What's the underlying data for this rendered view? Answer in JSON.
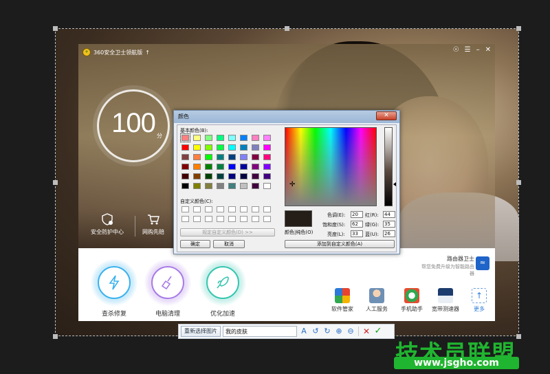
{
  "app": {
    "title": "360安全卫士领航版",
    "score": "100",
    "score_unit": "分",
    "features": [
      {
        "label": "安全防护中心",
        "icon": "shield-icon"
      },
      {
        "label": "网购先赔",
        "icon": "cart-icon"
      }
    ],
    "actions": [
      {
        "label": "查杀修复",
        "icon": "lightning-icon",
        "color": "#3bb2ee"
      },
      {
        "label": "电脑清理",
        "icon": "broom-icon",
        "color": "#a87be6"
      },
      {
        "label": "优化加速",
        "icon": "rocket-icon",
        "color": "#36c6b0"
      }
    ],
    "router": {
      "title": "路由器卫士",
      "subtitle": "帮您免费升级为智能路由器"
    },
    "tools": [
      {
        "label": "软件管家",
        "icon": "apps-icon"
      },
      {
        "label": "人工服务",
        "icon": "support-icon"
      },
      {
        "label": "手机助手",
        "icon": "phone-icon"
      },
      {
        "label": "宽带测速器",
        "icon": "speed-icon"
      },
      {
        "label": "更多",
        "icon": "more-icon"
      }
    ]
  },
  "color_dialog": {
    "title": "颜色",
    "basic_label": "基本颜色(B):",
    "custom_label": "自定义颜色(C):",
    "define_button": "规定自定义颜色(D) >>",
    "ok_button": "确定",
    "cancel_button": "取消",
    "add_button": "添加到自定义颜色(A)",
    "solid_label": "颜色|纯色(O)",
    "basic_colors": [
      "#ff8080",
      "#ffff80",
      "#80ff80",
      "#00ff80",
      "#80ffff",
      "#0080ff",
      "#ff80c0",
      "#ff80ff",
      "#ff0000",
      "#ffff00",
      "#80ff00",
      "#00ff40",
      "#00ffff",
      "#0080c0",
      "#8080c0",
      "#ff00ff",
      "#804040",
      "#ff8040",
      "#00ff00",
      "#008080",
      "#004080",
      "#8080ff",
      "#800040",
      "#ff0080",
      "#800000",
      "#ff8000",
      "#008000",
      "#008040",
      "#0000ff",
      "#0000a0",
      "#800080",
      "#8000ff",
      "#400000",
      "#804000",
      "#004000",
      "#004040",
      "#000080",
      "#000040",
      "#400040",
      "#400080",
      "#000000",
      "#808000",
      "#808040",
      "#808080",
      "#408080",
      "#c0c0c0",
      "#400040",
      "#ffffff"
    ],
    "fields": {
      "hue_label": "色调(E):",
      "hue": "20",
      "sat_label": "饱和度(S):",
      "sat": "62",
      "lum_label": "亮度(L):",
      "lum": "33",
      "red_label": "红(R):",
      "red": "44",
      "green_label": "绿(G):",
      "green": "35",
      "blue_label": "蓝(U):",
      "blue": "26"
    }
  },
  "toolbar": {
    "reselect": "重新选择图片",
    "name_value": "我的皮肤"
  },
  "watermark": {
    "text": "技术员联盟",
    "url": "www.jsgho.com"
  }
}
